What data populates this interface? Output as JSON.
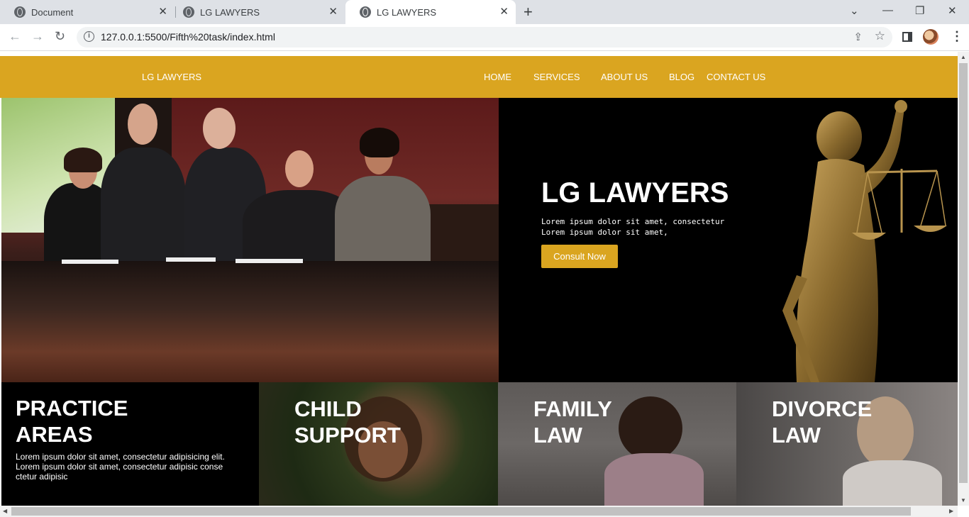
{
  "browser": {
    "tabs": [
      {
        "title": "Document"
      },
      {
        "title": "LG LAWYERS"
      },
      {
        "title": "LG LAWYERS"
      }
    ],
    "url": "127.0.0.1:5500/Fifth%20task/index.html"
  },
  "site": {
    "brand": "LG LAWYERS",
    "menu": [
      "HOME",
      "SERVICES",
      "ABOUT US",
      "BLOG",
      "CONTACT US"
    ],
    "hero": {
      "title": "LG LAWYERS",
      "text_line1": "Lorem ipsum dolor sit amet, consectetur",
      "text_line2": "Lorem ipsum dolor sit amet,",
      "cta": "Consult Now"
    },
    "cards": [
      {
        "title_line1": "PRACTICE",
        "title_line2": "AREAS",
        "text": "Lorem ipsum dolor sit amet, consectetur adipisicing elit. Lorem ipsum dolor sit amet, consectetur adipisic conse ctetur adipisic"
      },
      {
        "title_line1": "CHILD",
        "title_line2": "SUPPORT"
      },
      {
        "title_line1": "FAMILY",
        "title_line2": "LAW"
      },
      {
        "title_line1": "DIVORCE",
        "title_line2": "LAW"
      }
    ],
    "colors": {
      "accent": "#daa520",
      "dark": "#000000"
    }
  }
}
